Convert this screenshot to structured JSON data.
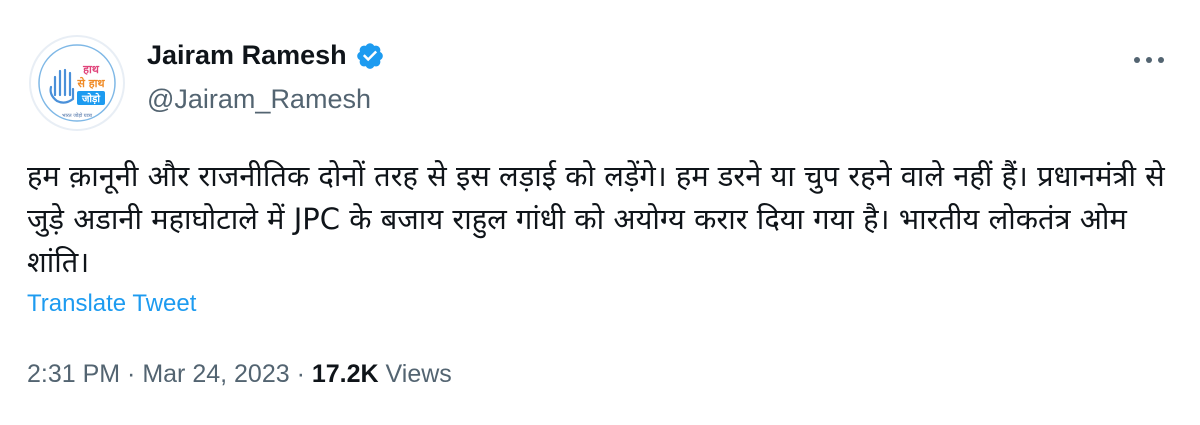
{
  "author": {
    "display_name": "Jairam Ramesh",
    "handle": "@Jairam_Ramesh",
    "verified_icon": "verified-badge-icon",
    "avatar_logo_text": [
      "हाथ",
      "से हाथ",
      "जोड़ो"
    ],
    "avatar_ring_text": "भारत जोड़ो यात्रा"
  },
  "tweet": {
    "text": "हम क़ानूनी और राजनीतिक दोनों तरह से इस लड़ाई को लड़ेंगे। हम डरने या चुप रहने वाले नहीं हैं। प्रधानमंत्री से जुड़े अडानी महाघोटाले में JPC के बजाय राहुल गांधी को अयोग्य करार दिया गया है। भारतीय लोकतंत्र ओम शांति।",
    "translate_label": "Translate Tweet"
  },
  "meta": {
    "time": "2:31 PM",
    "separator": " · ",
    "date": "Mar 24, 2023",
    "views_count": "17.2K",
    "views_label": " Views"
  },
  "colors": {
    "link": "#1d9bf0",
    "secondary_text": "#536471",
    "primary_text": "#0f1419",
    "verified": "#1d9bf0"
  },
  "more_icon": "more-horizontal-icon"
}
